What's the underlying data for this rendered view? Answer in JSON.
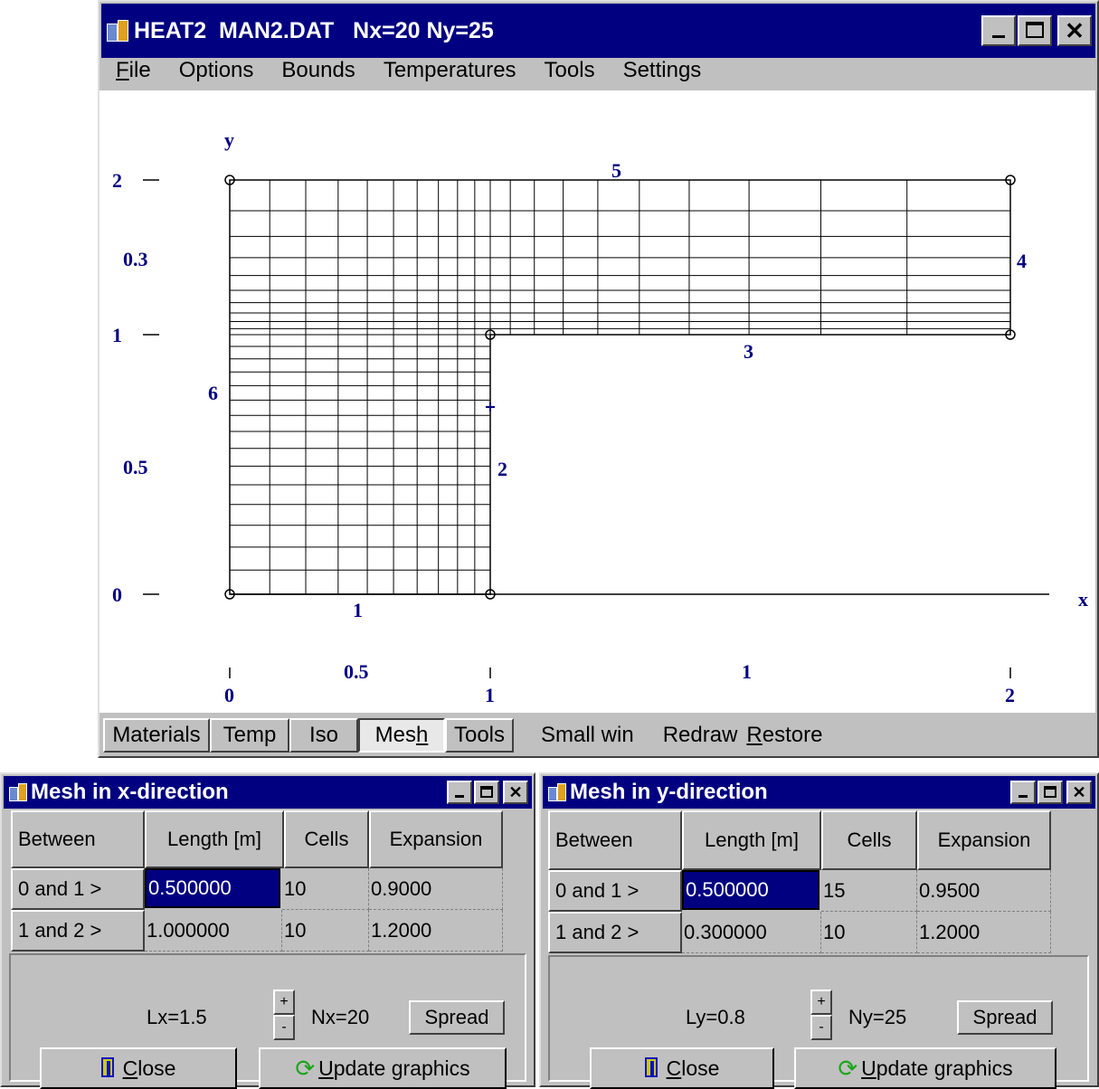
{
  "main_window": {
    "title": "HEAT2  MAN2.DAT   Nx=20 Ny=25",
    "menu": [
      {
        "label_u": "F",
        "label_rest": "ile"
      },
      {
        "label_u": "",
        "label_rest": "Options"
      },
      {
        "label_u": "",
        "label_rest": "Bounds"
      },
      {
        "label_u": "",
        "label_rest": "Temperatures"
      },
      {
        "label_u": "",
        "label_rest": "Tools"
      },
      {
        "label_u": "",
        "label_rest": "Settings"
      }
    ],
    "bottom_buttons": {
      "materials": "Materials",
      "temp": "Temp",
      "iso": "Iso",
      "mesh_pre": "Mes",
      "mesh_u": "h",
      "tools": "Tools",
      "small_win": "Small win",
      "redraw": "Redraw",
      "restore_u": "R",
      "restore_rest": "estore"
    }
  },
  "drawing": {
    "y_axis_label": "y",
    "x_axis_label": "x",
    "y_ticks": [
      "2",
      "1",
      "0"
    ],
    "y_spans": [
      "0.3",
      "0.5"
    ],
    "x_ticks": [
      "0",
      "1",
      "2"
    ],
    "x_spans": [
      "0.5",
      "1"
    ],
    "boundary_numbers": [
      "1",
      "2",
      "3",
      "4",
      "5",
      "6"
    ],
    "geometry_points_m": [
      [
        0,
        0
      ],
      [
        1,
        0
      ],
      [
        1,
        1
      ],
      [
        2,
        1
      ],
      [
        2,
        2
      ],
      [
        0,
        2
      ]
    ],
    "mesh_x": {
      "segments": [
        {
          "from": 0,
          "to": 1,
          "length": 0.5,
          "cells": 10,
          "expansion": 0.9
        },
        {
          "from": 1,
          "to": 2,
          "length": 1.0,
          "cells": 10,
          "expansion": 1.2
        }
      ]
    },
    "mesh_y": {
      "segments": [
        {
          "from": 0,
          "to": 1,
          "length": 0.5,
          "cells": 15,
          "expansion": 0.95
        },
        {
          "from": 1,
          "to": 2,
          "length": 0.3,
          "cells": 10,
          "expansion": 1.2
        }
      ]
    },
    "line_color": "#000000",
    "label_color": "#000080"
  },
  "mesh_x_dialog": {
    "title": "Mesh in x-direction",
    "headers": [
      "Between",
      "Length [m]",
      "Cells",
      "Expansion"
    ],
    "rows": [
      {
        "between": "0 and 1 >",
        "length": "0.500000",
        "cells": "10",
        "expansion": "0.9000"
      },
      {
        "between": "1 and 2 >",
        "length": "1.000000",
        "cells": "10",
        "expansion": "1.2000"
      }
    ],
    "total": "Lx=1.5",
    "count": "Nx=20",
    "spin_plus": "+",
    "spin_minus": "-",
    "spread": "Spread",
    "close_u": "C",
    "close_rest": "lose",
    "update_u": "U",
    "update_rest": "pdate graphics"
  },
  "mesh_y_dialog": {
    "title": "Mesh in y-direction",
    "headers": [
      "Between",
      "Length [m]",
      "Cells",
      "Expansion"
    ],
    "rows": [
      {
        "between": "0 and 1 >",
        "length": "0.500000",
        "cells": "15",
        "expansion": "0.9500"
      },
      {
        "between": "1 and 2 >",
        "length": "0.300000",
        "cells": "10",
        "expansion": "1.2000"
      }
    ],
    "total": "Ly=0.8",
    "count": "Ny=25",
    "spin_plus": "+",
    "spin_minus": "-",
    "spread": "Spread",
    "close_u": "C",
    "close_rest": "lose",
    "update_u": "U",
    "update_rest": "pdate graphics"
  },
  "colors": {
    "title_bg": "#000080",
    "face": "#c0c0c0",
    "selection": "#000080",
    "update_icon": "#1aa51a",
    "close_icon": "#1010c0"
  }
}
